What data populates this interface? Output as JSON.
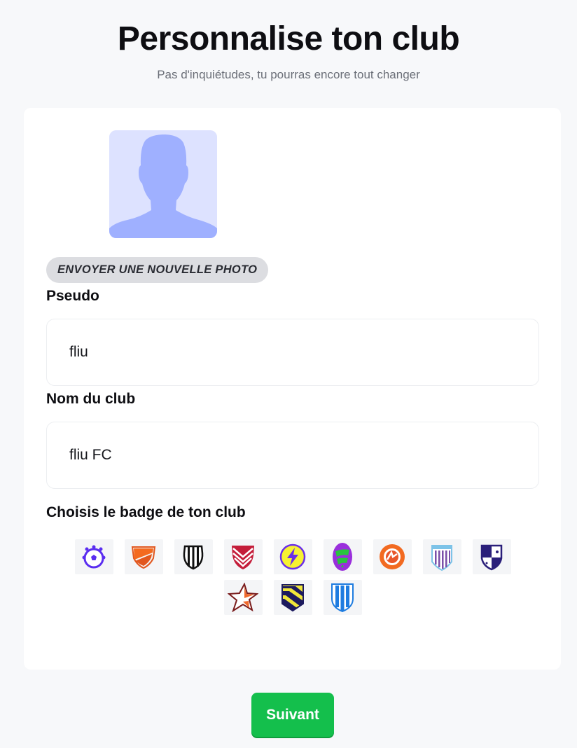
{
  "header": {
    "title": "Personnalise ton club",
    "subtitle": "Pas d'inquiétudes, tu pourras encore tout changer"
  },
  "avatar": {
    "icon": "person-silhouette-icon",
    "bg_color": "#dde2ff",
    "fg_color": "#9fb0ff"
  },
  "upload_button": {
    "label": "ENVOYER UNE NOUVELLE PHOTO"
  },
  "pseudo": {
    "label": "Pseudo",
    "value": "fliu"
  },
  "club_name": {
    "label": "Nom du club",
    "value": "fliu FC"
  },
  "badge_section": {
    "label": "Choisis le badge de ton club",
    "badges": [
      "badge-ball-purple",
      "badge-shield-orange",
      "badge-striped-black",
      "badge-chevrons-red",
      "badge-lightning-purple",
      "badge-oval-green-purple",
      "badge-round-orange",
      "badge-gate-purple",
      "badge-quartered-navy",
      "badge-star-orange",
      "badge-stripes-yellow-navy",
      "badge-stripes-blue"
    ]
  },
  "footer": {
    "next_label": "Suivant",
    "accent_color": "#14bf4c"
  }
}
